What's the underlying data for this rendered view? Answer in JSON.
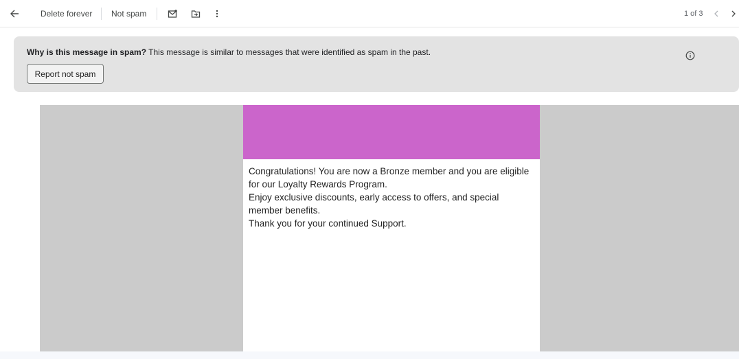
{
  "toolbar": {
    "back_icon": "arrow-left-icon",
    "delete_forever_label": "Delete forever",
    "not_spam_label": "Not spam",
    "mark_unread_icon": "mark-unread-icon",
    "move_to_icon": "move-to-folder-icon",
    "more_icon": "more-vert-icon",
    "pager_text": "1 of 3",
    "prev_icon": "chevron-left-icon",
    "next_icon": "chevron-right-icon"
  },
  "spam_banner": {
    "question": "Why is this message in spam?",
    "explanation": " This message is similar to messages that were identified as spam in the past.",
    "report_button_label": "Report not spam",
    "info_icon": "info-icon"
  },
  "email": {
    "header_color": "#cb65cb",
    "lines": [
      "Congratulations! You are now a Bronze member and you are eligible for our Loyalty Rewards Program.",
      "Enjoy exclusive discounts, early access to offers, and special member benefits.",
      "Thank you for your continued Support."
    ]
  }
}
